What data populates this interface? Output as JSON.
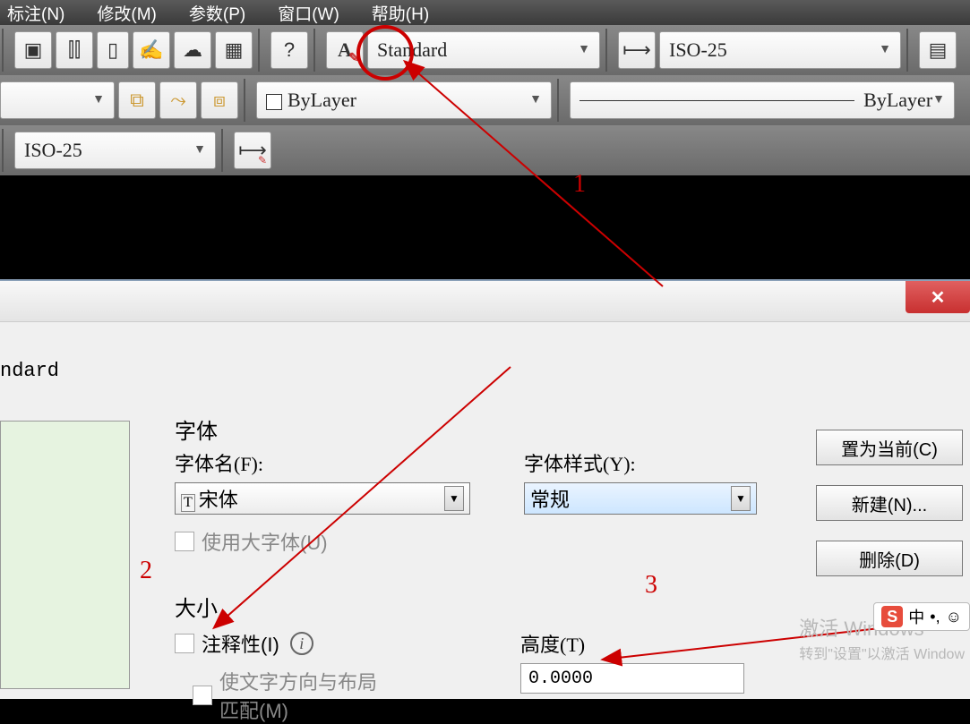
{
  "menubar": {
    "annotate": "标注(N)",
    "modify": "修改(M)",
    "params": "参数(P)",
    "window": "窗口(W)",
    "help": "帮助(H)"
  },
  "toolbar1": {
    "text_style_dd": "Standard",
    "dim_style_dd": "ISO-25"
  },
  "toolbar2": {
    "layer_dd": "ByLayer",
    "linetype_dd": "ByLayer"
  },
  "toolbar3": {
    "dim_dd": "ISO-25"
  },
  "dialog": {
    "partial_title": "ndard",
    "font_section": "字体",
    "font_name_label": "字体名(F):",
    "font_name_value": "宋体",
    "font_style_label": "字体样式(Y):",
    "font_style_value": "常规",
    "bigfont_label": "使用大字体(U)",
    "size_section": "大小",
    "annotative_label": "注释性(I)",
    "match_orient_label": "使文字方向与布局",
    "match_orient_label2": "匹配(M)",
    "height_label": "高度(T)",
    "height_value": "0.0000",
    "btn_set_current": "置为当前(C)",
    "btn_new": "新建(N)...",
    "btn_delete": "删除(D)"
  },
  "annotations": {
    "n1": "1",
    "n2": "2",
    "n3": "3"
  },
  "watermark": {
    "line1": "激活 Windows",
    "line2": "转到\"设置\"以激活 Window"
  },
  "ime": {
    "cn": "中",
    "punct": "•,",
    "face": "☺"
  }
}
